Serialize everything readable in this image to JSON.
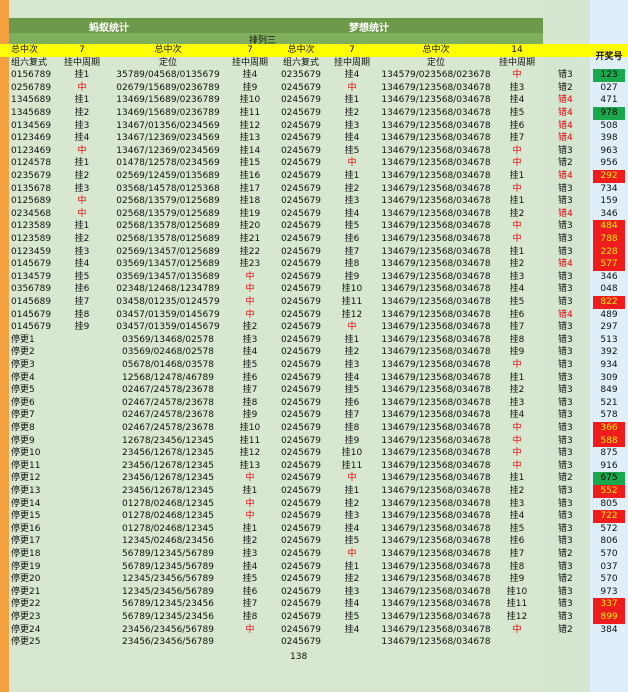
{
  "headers": {
    "group1": "蚂蚁统计",
    "group2": "梦想统计",
    "subtitle": "排列三",
    "row3": [
      "总中次",
      "7",
      "总中次",
      "7",
      "总中次",
      "7",
      "总中次",
      "14"
    ],
    "row4": [
      "组六复式",
      "挂中周期",
      "定位",
      "挂中周期",
      "组六复式",
      "挂中周期",
      "定位",
      "挂中周期"
    ],
    "draw_header": "开奖号"
  },
  "footer_count": "138",
  "rows": [
    [
      "0156789",
      "挂1",
      "35789/04568/0135679",
      "挂4",
      "0235679",
      "挂4",
      "134579/023568/023678",
      "中",
      "错3",
      "123"
    ],
    [
      "0256789",
      "中",
      "02679/15689/0236789",
      "挂9",
      "0245679",
      "中",
      "134679/123568/034678",
      "挂3",
      "错2",
      "027"
    ],
    [
      "1345689",
      "挂1",
      "13469/15689/0236789",
      "挂10",
      "0245679",
      "挂1",
      "134679/123568/034678",
      "挂4",
      "错4",
      "471"
    ],
    [
      "1345689",
      "挂2",
      "13469/15689/0236789",
      "挂11",
      "0245679",
      "挂2",
      "134679/123568/034678",
      "挂5",
      "错4",
      "978"
    ],
    [
      "0134569",
      "挂3",
      "13467/01356/0234569",
      "挂12",
      "0245679",
      "挂3",
      "134679/123568/034678",
      "挂6",
      "错4",
      "508"
    ],
    [
      "0123469",
      "挂4",
      "13467/12369/0234569",
      "挂13",
      "0245679",
      "挂4",
      "134679/123568/034678",
      "挂7",
      "错4",
      "398"
    ],
    [
      "0123469",
      "中",
      "13467/12369/0234569",
      "挂14",
      "0245679",
      "挂5",
      "134679/123568/034678",
      "中",
      "错3",
      "963"
    ],
    [
      "0124578",
      "挂1",
      "01478/12578/0234569",
      "挂15",
      "0245679",
      "中",
      "134679/123568/034678",
      "中",
      "错2",
      "956"
    ],
    [
      "0235679",
      "挂2",
      "02569/12459/0135689",
      "挂16",
      "0245679",
      "挂1",
      "134679/123568/034678",
      "挂1",
      "错4",
      "292"
    ],
    [
      "0135678",
      "挂3",
      "03568/14578/0125368",
      "挂17",
      "0245679",
      "挂2",
      "134679/123568/034678",
      "中",
      "错3",
      "734"
    ],
    [
      "0125689",
      "中",
      "02568/13579/0125689",
      "挂18",
      "0245679",
      "挂3",
      "134679/123568/034678",
      "挂1",
      "错3",
      "159"
    ],
    [
      "0234568",
      "中",
      "02568/13579/0125689",
      "挂19",
      "0245679",
      "挂4",
      "134679/123568/034678",
      "挂2",
      "错4",
      "346"
    ],
    [
      "0123589",
      "挂1",
      "02568/13578/0125689",
      "挂20",
      "0245679",
      "挂5",
      "134679/123568/034678",
      "中",
      "错3",
      "484"
    ],
    [
      "0123589",
      "挂2",
      "02568/13578/0125689",
      "挂21",
      "0245679",
      "挂6",
      "134679/123568/034678",
      "中",
      "错3",
      "788"
    ],
    [
      "0123459",
      "挂3",
      "02569/13457/0125689",
      "挂22",
      "0245679",
      "挂7",
      "134679/123568/034678",
      "挂1",
      "错3",
      "228"
    ],
    [
      "0145679",
      "挂4",
      "03569/13457/0125689",
      "挂23",
      "0245679",
      "挂8",
      "134679/123568/034678",
      "挂2",
      "错4",
      "577"
    ],
    [
      "0134579",
      "挂5",
      "03569/13457/0135689",
      "中",
      "0245679",
      "挂9",
      "134679/123568/034678",
      "挂3",
      "错3",
      "346"
    ],
    [
      "0356789",
      "挂6",
      "02348/12468/1234789",
      "中",
      "0245679",
      "挂10",
      "134679/123568/034678",
      "挂4",
      "错3",
      "048"
    ],
    [
      "0145689",
      "挂7",
      "03458/01235/0124579",
      "中",
      "0245679",
      "挂11",
      "134679/123568/034678",
      "挂5",
      "错3",
      "822"
    ],
    [
      "0145679",
      "挂8",
      "03457/01359/0145679",
      "中",
      "0245679",
      "挂12",
      "134679/123568/034678",
      "挂6",
      "错4",
      "489"
    ],
    [
      "0145679",
      "挂9",
      "03457/01359/0145679",
      "挂2",
      "0245679",
      "中",
      "134679/123568/034678",
      "挂7",
      "错3",
      "297"
    ],
    [
      "停更1",
      "",
      "03569/13468/02578",
      "挂3",
      "0245679",
      "挂1",
      "134679/123568/034678",
      "挂8",
      "错3",
      "513"
    ],
    [
      "停更2",
      "",
      "03569/02468/02578",
      "挂4",
      "0245679",
      "挂2",
      "134679/123568/034678",
      "挂9",
      "错3",
      "392"
    ],
    [
      "停更3",
      "",
      "05678/01468/03578",
      "挂5",
      "0245679",
      "挂3",
      "134679/123568/034678",
      "中",
      "错3",
      "934"
    ],
    [
      "停更4",
      "",
      "12568/12478/46789",
      "挂6",
      "0245679",
      "挂4",
      "134679/123568/034678",
      "挂1",
      "错3",
      "309"
    ],
    [
      "停更5",
      "",
      "02467/24578/23678",
      "挂7",
      "0245679",
      "挂5",
      "134679/123568/034678",
      "挂2",
      "错3",
      "849"
    ],
    [
      "停更6",
      "",
      "02467/24578/23678",
      "挂8",
      "0245679",
      "挂6",
      "134679/123568/034678",
      "挂3",
      "错3",
      "521"
    ],
    [
      "停更7",
      "",
      "02467/24578/23678",
      "挂9",
      "0245679",
      "挂7",
      "134679/123568/034678",
      "挂4",
      "错3",
      "578"
    ],
    [
      "停更8",
      "",
      "02467/24578/23678",
      "挂10",
      "0245679",
      "挂8",
      "134679/123568/034678",
      "中",
      "错3",
      "366"
    ],
    [
      "停更9",
      "",
      "12678/23456/12345",
      "挂11",
      "0245679",
      "挂9",
      "134679/123568/034678",
      "中",
      "错3",
      "588"
    ],
    [
      "停更10",
      "",
      "23456/12678/12345",
      "挂12",
      "0245679",
      "挂10",
      "134679/123568/034678",
      "中",
      "错3",
      "875"
    ],
    [
      "停更11",
      "",
      "23456/12678/12345",
      "挂13",
      "0245679",
      "挂11",
      "134679/123568/034678",
      "中",
      "错3",
      "916"
    ],
    [
      "停更12",
      "",
      "23456/12678/12345",
      "中",
      "0245679",
      "中",
      "134679/123568/034678",
      "挂1",
      "错2",
      "675"
    ],
    [
      "停更13",
      "",
      "23456/12678/12345",
      "挂1",
      "0245679",
      "挂1",
      "134679/123568/034678",
      "挂2",
      "错3",
      "552"
    ],
    [
      "停更14",
      "",
      "01278/02468/12345",
      "中",
      "0245679",
      "挂2",
      "134679/123568/034678",
      "挂3",
      "错3",
      "805"
    ],
    [
      "停更15",
      "",
      "01278/02468/12345",
      "中",
      "0245679",
      "挂3",
      "134679/123568/034678",
      "挂4",
      "错3",
      "722"
    ],
    [
      "停更16",
      "",
      "01278/02468/12345",
      "挂1",
      "0245679",
      "挂4",
      "134679/123568/034678",
      "挂5",
      "错3",
      "572"
    ],
    [
      "停更17",
      "",
      "12345/02468/23456",
      "挂2",
      "0245679",
      "挂5",
      "134679/123568/034678",
      "挂6",
      "错3",
      "806"
    ],
    [
      "停更18",
      "",
      "56789/12345/56789",
      "挂3",
      "0245679",
      "中",
      "134679/123568/034678",
      "挂7",
      "错2",
      "570"
    ],
    [
      "停更19",
      "",
      "56789/12345/56789",
      "挂4",
      "0245679",
      "挂1",
      "134679/123568/034678",
      "挂8",
      "错3",
      "037"
    ],
    [
      "停更20",
      "",
      "12345/23456/56789",
      "挂5",
      "0245679",
      "挂2",
      "134679/123568/034678",
      "挂9",
      "错2",
      "570"
    ],
    [
      "停更21",
      "",
      "12345/23456/56789",
      "挂6",
      "0245679",
      "挂3",
      "134679/123568/034678",
      "挂10",
      "错3",
      "973"
    ],
    [
      "停更22",
      "",
      "56789/12345/23456",
      "挂7",
      "0245679",
      "挂4",
      "134679/123568/034678",
      "挂11",
      "错3",
      "337"
    ],
    [
      "停更23",
      "",
      "56789/12345/23456",
      "挂8",
      "0245679",
      "挂5",
      "134679/123568/034678",
      "挂12",
      "错3",
      "899"
    ],
    [
      "停更24",
      "",
      "23456/23456/56789",
      "中",
      "0245679",
      "挂4",
      "134679/123568/034678",
      "中",
      "错2",
      "384"
    ],
    [
      "停更25",
      "",
      "23456/23456/56789",
      "",
      "0245679",
      "",
      "134679/123568/034678",
      "",
      "",
      ""
    ]
  ],
  "colors": {
    "row_highlight": "#ffff00",
    "header_green": "#6d9a4a",
    "hit_red": "#e8000a",
    "badge_green": "#19a84b",
    "badge_red": "#ee1c1c"
  },
  "badges": {
    "green": [
      "123",
      "978",
      "675"
    ],
    "red": [
      "292",
      "484",
      "788",
      "228",
      "577",
      "822",
      "366",
      "588",
      "552",
      "722",
      "337",
      "899"
    ]
  }
}
